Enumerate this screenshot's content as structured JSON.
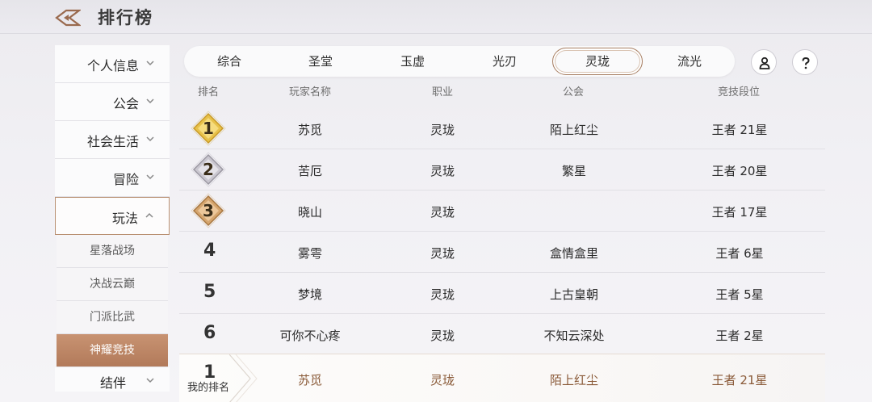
{
  "header": {
    "title": "排行榜"
  },
  "sidebar": {
    "items": [
      {
        "label": "个人信息"
      },
      {
        "label": "公会"
      },
      {
        "label": "社会生活"
      },
      {
        "label": "冒险"
      },
      {
        "label": "玩法"
      }
    ],
    "sub_items": [
      "星落战场",
      "决战云巅",
      "门派比武",
      "神耀竞技"
    ],
    "selected_sub": "神耀竞技",
    "bottom_partial": "结伴"
  },
  "tabs": [
    "综合",
    "圣堂",
    "玉虚",
    "光刃",
    "灵珑",
    "流光"
  ],
  "active_tab": "灵珑",
  "columns": {
    "rank": "排名",
    "name": "玩家名称",
    "job": "职业",
    "guild": "公会",
    "tier": "竞技段位"
  },
  "rows": [
    {
      "rank": "1",
      "name": "苏觅",
      "job": "灵珑",
      "guild": "陌上红尘",
      "tier": "王者 21星"
    },
    {
      "rank": "2",
      "name": "苦厄",
      "job": "灵珑",
      "guild": "繁星",
      "tier": "王者 20星"
    },
    {
      "rank": "3",
      "name": "晓山",
      "job": "灵珑",
      "guild": "",
      "tier": "王者 17星"
    },
    {
      "rank": "4",
      "name": "雾雩",
      "job": "灵珑",
      "guild": "盒情盒里",
      "tier": "王者 6星"
    },
    {
      "rank": "5",
      "name": "梦境",
      "job": "灵珑",
      "guild": "上古皇朝",
      "tier": "王者 5星"
    },
    {
      "rank": "6",
      "name": "可你不心疼",
      "job": "灵珑",
      "guild": "不知云深处",
      "tier": "王者 2星"
    }
  ],
  "my_rank": {
    "rank": "1",
    "label": "我的排名",
    "name": "苏觅",
    "job": "灵珑",
    "guild": "陌上红尘",
    "tier": "王者 21星"
  },
  "icons": {
    "back": "back-arrow-icon",
    "profile": "person-icon",
    "help": "question-icon"
  },
  "colors": {
    "accent": "#b27a5a",
    "gold": "#e7c14a",
    "silver": "#c9c6cf",
    "bronze": "#d5a56e"
  }
}
